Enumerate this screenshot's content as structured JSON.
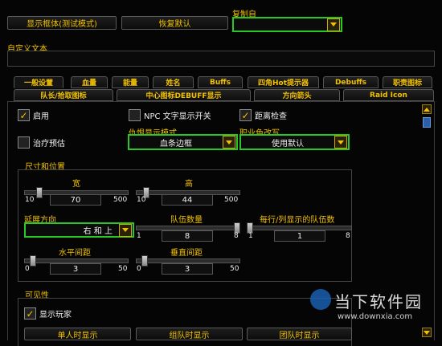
{
  "top": {
    "show_frame_button": "显示框体(测试模式)",
    "restore_default_button": "恢复默认",
    "copy_from_label": "复制自",
    "copy_from_value": ""
  },
  "custom_text": {
    "label": "自定义文本",
    "value": ""
  },
  "tabs_row1": [
    "一般设置",
    "血量",
    "能量",
    "姓名",
    "Buffs",
    "四角Hot提示器",
    "Debuffs",
    "职责图标"
  ],
  "tabs_row2": [
    "队长/拾取图标",
    "中心图标DEBUFF显示",
    "方向箭头",
    "Raid Icon"
  ],
  "checks": {
    "enable": "启用",
    "npc_text": "NPC 文字显示开关",
    "range_check": "距离检查",
    "heal_predict": "治疗预估"
  },
  "hostile_mode": {
    "label": "仇恨显示模式",
    "value": "血条边框"
  },
  "class_color": {
    "label": "职业色改写",
    "value": "使用默认"
  },
  "size": {
    "section": "尺寸和位置",
    "width": {
      "label": "宽",
      "min": "10",
      "value": "70",
      "max": "500",
      "fraction": 0.12
    },
    "height": {
      "label": "高",
      "min": "10",
      "value": "44",
      "max": "500",
      "fraction": 0.07
    }
  },
  "grow_dir": {
    "label": "延展方向",
    "value": "右 和 上"
  },
  "group_count": {
    "label": "队伍数量",
    "min": "1",
    "value": "8",
    "max": "8",
    "fraction": 1.0
  },
  "per_row": {
    "label": "每行/列显示的队伍数",
    "min": "1",
    "value": "1",
    "max": "8",
    "fraction": 0.0
  },
  "h_spacing": {
    "label": "水平间距",
    "min": "0",
    "value": "3",
    "max": "50",
    "fraction": 0.06
  },
  "v_spacing": {
    "label": "垂直间距",
    "min": "0",
    "value": "3",
    "max": "50",
    "fraction": 0.06
  },
  "visibility": {
    "section": "可见性",
    "show_player": "显示玩家",
    "solo": "单人时显示",
    "party": "组队时显示",
    "raid": "团队时显示"
  },
  "watermark": {
    "name": "当下软件园",
    "url": "www.downxia.com"
  },
  "colors": {
    "accent": "#f2c100",
    "highlight": "#28c828"
  }
}
